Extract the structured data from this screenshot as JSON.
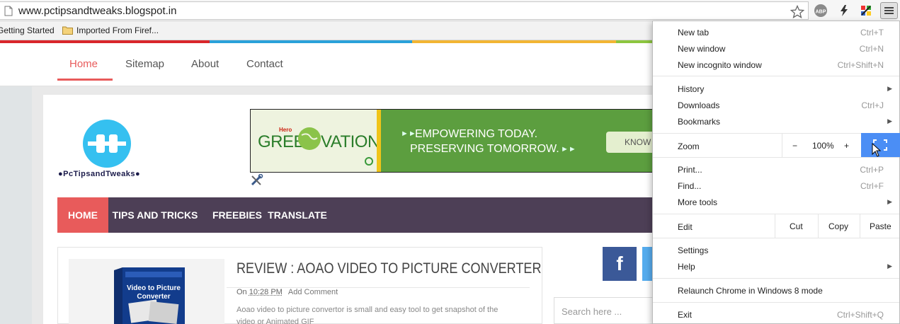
{
  "browser": {
    "url": "www.pctipsandtweaks.blogspot.in",
    "bookmarks": [
      "Getting Started",
      "Imported From Firef..."
    ],
    "extensions": [
      "abp-icon",
      "lightning-icon",
      "puzzle-icon"
    ]
  },
  "site": {
    "topnav": [
      "Home",
      "Sitemap",
      "About",
      "Contact"
    ],
    "logo_text": "●PcTipsandTweaks●",
    "banner": {
      "hero": "Hero",
      "brand": "GREEN VATION",
      "line1": "EMPOWERING TODAY.",
      "line2": "PRESERVING TOMORROW.",
      "cta": "KNOW"
    },
    "mainnav": [
      "HOME",
      "TIPS AND TRICKS",
      "FREEBIES",
      "TRANSLATE"
    ],
    "post": {
      "title": "REVIEW : AOAO VIDEO TO PICTURE CONVERTER",
      "meta_on": "On",
      "meta_time": "10:28 PM",
      "meta_comment": "Add Comment",
      "excerpt_line1": "Aoao video to picture convertor is small and easy tool to get snapshot of the",
      "excerpt_line2": "video or Animated GIF",
      "thumb_label": "Video to Picture Converter"
    },
    "facebook_label": "f",
    "search_placeholder": "Search here ..."
  },
  "menu": {
    "new_tab": "New tab",
    "new_tab_sc": "Ctrl+T",
    "new_window": "New window",
    "new_window_sc": "Ctrl+N",
    "incognito": "New incognito window",
    "incognito_sc": "Ctrl+Shift+N",
    "history": "History",
    "downloads": "Downloads",
    "downloads_sc": "Ctrl+J",
    "bookmarks": "Bookmarks",
    "zoom": "Zoom",
    "zoom_minus": "−",
    "zoom_value": "100%",
    "zoom_plus": "+",
    "print": "Print...",
    "print_sc": "Ctrl+P",
    "find": "Find...",
    "find_sc": "Ctrl+F",
    "more_tools": "More tools",
    "edit": "Edit",
    "cut": "Cut",
    "copy": "Copy",
    "paste": "Paste",
    "settings": "Settings",
    "help": "Help",
    "relaunch": "Relaunch Chrome in Windows 8 mode",
    "exit": "Exit",
    "exit_sc": "Ctrl+Shift+Q"
  },
  "colors": {
    "strip": [
      "#d9262b",
      "#2aa1da",
      "#f2b533",
      "#8dc63f"
    ],
    "accent_red": "#e85b5b",
    "nav_purple": "#4d3f56",
    "menu_blue": "#4b8ef5"
  }
}
